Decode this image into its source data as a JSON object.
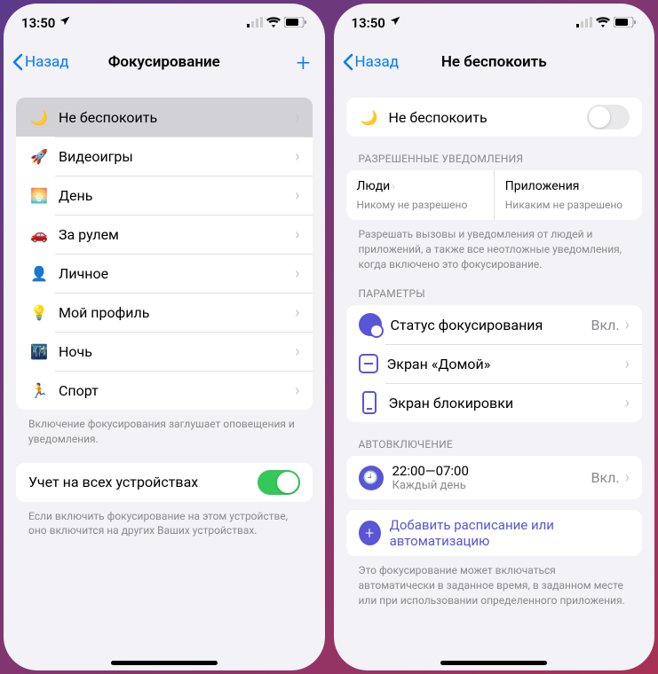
{
  "status": {
    "time": "13:50"
  },
  "left": {
    "back": "Назад",
    "title": "Фокусирование",
    "items": [
      {
        "icon": "🌙",
        "color": "#5856d6",
        "label": "Не беспокоить",
        "selected": true
      },
      {
        "icon": "🚀",
        "color": "#2566e0",
        "label": "Видеоигры"
      },
      {
        "icon": "🌅",
        "color": "#ff9500",
        "label": "День"
      },
      {
        "icon": "🚗",
        "color": "#3a5dae",
        "label": "За рулем"
      },
      {
        "icon": "👤",
        "color": "#af52de",
        "label": "Личное"
      },
      {
        "icon": "💡",
        "color": "#ff9500",
        "label": "Мой профиль"
      },
      {
        "icon": "🌃",
        "color": "#2a4b8d",
        "label": "Ночь"
      },
      {
        "icon": "🏃",
        "color": "#34c759",
        "label": "Спорт"
      }
    ],
    "footer1": "Включение фокусирования заглушает оповещения и уведомления.",
    "sync_label": "Учет на всех устройствах",
    "footer2": "Если включить фокусирование на этом устройстве, оно включится на других Ваших устройствах."
  },
  "right": {
    "back": "Назад",
    "title": "Не беспокоить",
    "dnd_label": "Не беспокоить",
    "allowed_header": "РАЗРЕШЕННЫЕ УВЕДОМЛЕНИЯ",
    "people_title": "Люди",
    "people_sub": "Никому не разрешено",
    "apps_title": "Приложения",
    "apps_sub": "Никаким не разрешено",
    "allowed_footer": "Разрешать вызовы и уведомления от людей и приложений, а также все неотложные уведомления, когда включено это фокусирование.",
    "params_header": "ПАРАМЕТРЫ",
    "param_status": "Статус фокусирования",
    "param_status_val": "Вкл.",
    "param_home": "Экран «Домой»",
    "param_lock": "Экран блокировки",
    "auto_header": "АВТОВКЛЮЧЕНИЕ",
    "schedule_time": "22:00—07:00",
    "schedule_sub": "Каждый день",
    "schedule_val": "Вкл.",
    "add_label": "Добавить расписание или автоматизацию",
    "auto_footer": "Это фокусирование может включаться автоматически в заданное время, в заданном месте или при использовании определенного приложения."
  }
}
